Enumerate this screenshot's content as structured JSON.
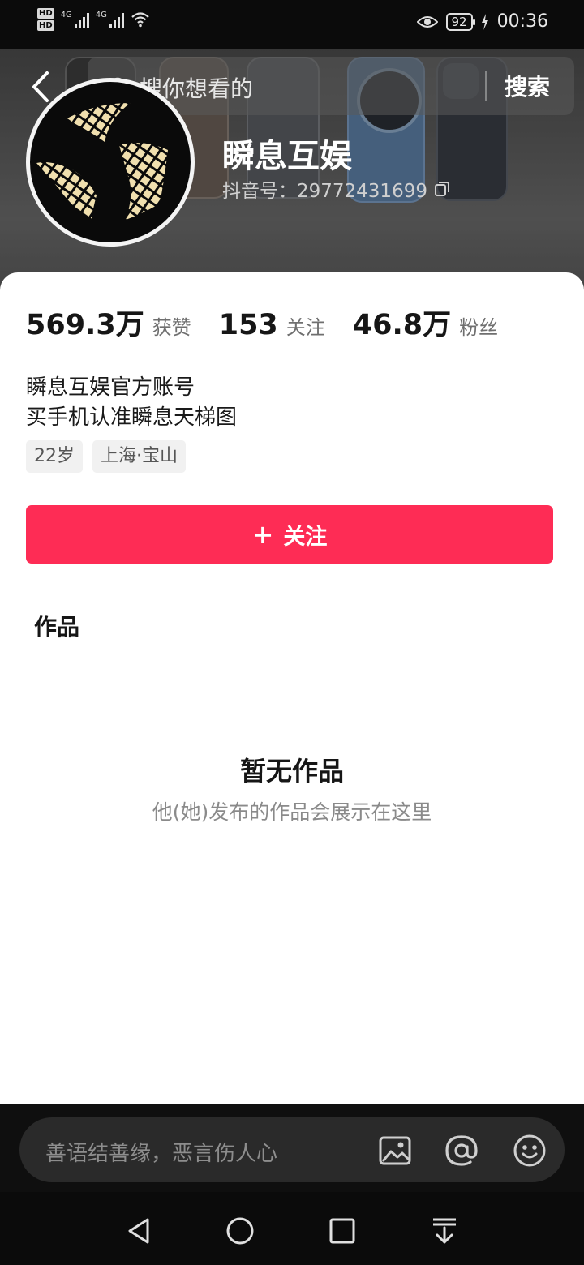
{
  "status_bar": {
    "hd_labels": [
      "HD",
      "HD"
    ],
    "sim1_label": "4G",
    "sim2_label": "4G",
    "battery": "92",
    "time": "00:36"
  },
  "header": {
    "search_placeholder": "搜你想看的",
    "search_button": "搜索"
  },
  "profile": {
    "name": "瞬息互娱",
    "douyin_id": "抖音号：29772431699",
    "stats": [
      {
        "value": "569.3万",
        "label": "获赞"
      },
      {
        "value": "153",
        "label": "关注"
      },
      {
        "value": "46.8万",
        "label": "粉丝"
      }
    ],
    "bio_lines": [
      "瞬息互娱官方账号",
      "买手机认准瞬息天梯图"
    ],
    "tags": [
      "22岁",
      "上海·宝山"
    ],
    "follow_label": "关注"
  },
  "tabs": {
    "works": "作品"
  },
  "empty_state": {
    "title": "暂无作品",
    "subtitle": "他(她)发布的作品会展示在这里"
  },
  "comment_bar": {
    "placeholder": "善语结善缘，恶言伤人心"
  },
  "colors": {
    "accent": "#fe2c55",
    "card_bg": "#ffffff",
    "dark_bg": "#0b0b0b"
  },
  "icons": [
    "back-arrow-icon",
    "search-icon",
    "copy-icon",
    "plus-icon",
    "image-icon",
    "at-icon",
    "emoji-icon",
    "nav-back-icon",
    "nav-home-icon",
    "nav-recent-icon",
    "nav-download-icon"
  ]
}
